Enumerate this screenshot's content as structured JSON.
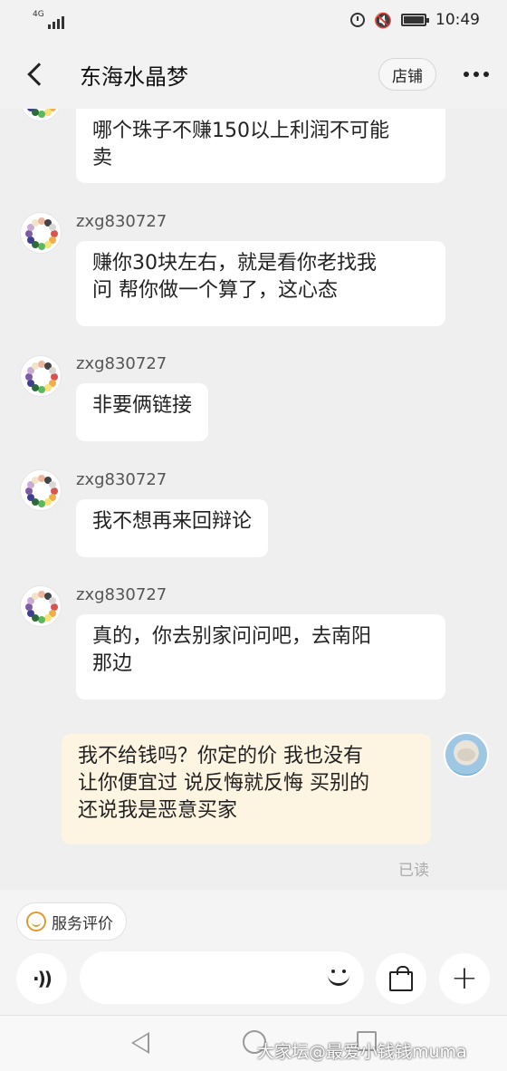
{
  "status_bar": {
    "network": "4G",
    "time": "10:49"
  },
  "header": {
    "title": "东海水晶梦",
    "shop_label": "店铺"
  },
  "messages": [
    {
      "sender": "",
      "text": "哪个珠子不赚150以上利润不可能\n卖"
    },
    {
      "sender": "zxg830727",
      "text": "赚你30块左右，就是看你老找我\n问 帮你做一个算了，这心态"
    },
    {
      "sender": "zxg830727",
      "text": "非要俩链接"
    },
    {
      "sender": "zxg830727",
      "text": "我不想再来回辩论"
    },
    {
      "sender": "zxg830727",
      "text": "真的，你去别家问问吧，去南阳\n那边"
    },
    {
      "sender": "me",
      "text": "我不给钱吗？你定的价 我也没有\n让你便宜过 说反悔就反悔 买别的\n还说我是恶意买家"
    }
  ],
  "read_status": "已读",
  "bottom": {
    "service_label": "服务评价"
  },
  "watermark": "大家坛@最爱小钱钱muma",
  "colors": {
    "my_bubble": "#fef4e2",
    "other_bubble": "#ffffff",
    "background": "#efefef"
  },
  "icons": [
    "back-icon",
    "more-icon",
    "voice-icon",
    "smile-icon",
    "bag-icon",
    "plus-icon"
  ]
}
